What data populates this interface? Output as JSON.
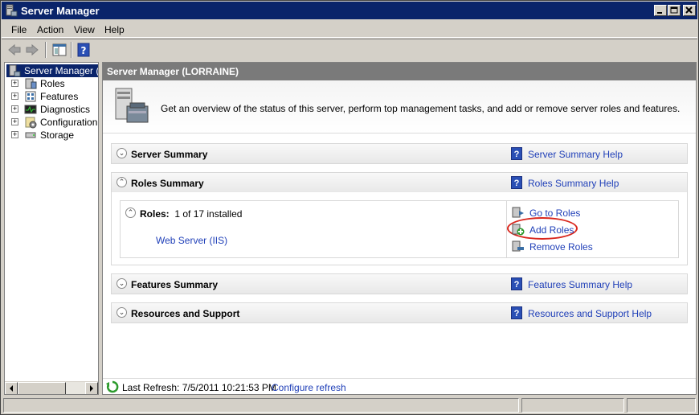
{
  "window": {
    "title": "Server Manager",
    "controls": {
      "minimize": "_",
      "maximize": "□",
      "close": "✕"
    }
  },
  "menu": [
    "File",
    "Action",
    "View",
    "Help"
  ],
  "toolbar": {
    "icons": [
      "back-arrow-icon",
      "forward-arrow-icon",
      "show-hide-console-tree-icon",
      "help-icon"
    ]
  },
  "tree": {
    "root": "Server Manager (LORRAINE)",
    "items": [
      {
        "label": "Roles",
        "icon": "roles-icon"
      },
      {
        "label": "Features",
        "icon": "features-icon"
      },
      {
        "label": "Diagnostics",
        "icon": "diagnostics-icon"
      },
      {
        "label": "Configuration",
        "icon": "configuration-icon"
      },
      {
        "label": "Storage",
        "icon": "storage-icon"
      }
    ],
    "expander": "+"
  },
  "main": {
    "header": "Server Manager (LORRAINE)",
    "overview_text": "Get an overview of the status of this server, perform top management tasks, and add or remove server roles and features.",
    "sections": {
      "server_summary": {
        "title": "Server Summary",
        "help": "Server Summary Help"
      },
      "roles_summary": {
        "title": "Roles Summary",
        "help": "Roles Summary Help",
        "roles_label": "Roles:",
        "roles_count": "1 of 17 installed",
        "installed_role": "Web Server (IIS)",
        "tasks": [
          "Go to Roles",
          "Add Roles",
          "Remove Roles"
        ]
      },
      "features_summary": {
        "title": "Features Summary",
        "help": "Features Summary Help"
      },
      "resources_support": {
        "title": "Resources and Support",
        "help": "Resources and Support Help"
      }
    },
    "help_glyph": "?",
    "chev_down": "⌄",
    "chev_up": "⌃"
  },
  "refresh": {
    "text": "Last Refresh: 7/5/2011 10:21:53 PM",
    "link": "Configure refresh"
  },
  "colors": {
    "titlebar": "#0a246a",
    "link": "#1f3fb8",
    "highlight_oval": "#d9261c",
    "header_bg": "#7a7a7a"
  }
}
